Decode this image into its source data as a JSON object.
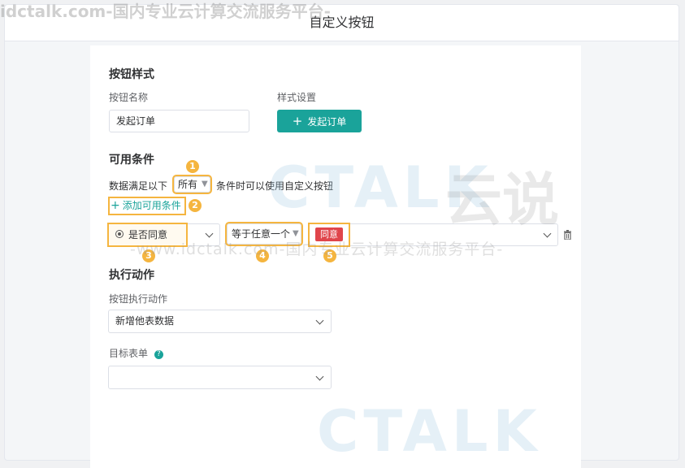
{
  "watermark_top": "idctalk.com-国内专业云计算交流服务平台-",
  "watermark_mid": "-www.idctalk.com-国内专业云计算交流服务平台-",
  "watermark_logo_text": "CTALK",
  "watermark_logo_cn": "云说",
  "page_title": "自定义按钮",
  "button_style": {
    "section_title": "按钮样式",
    "name_label": "按钮名称",
    "name_value": "发起订单",
    "style_label": "样式设置",
    "preview_plus": "+",
    "preview_label": "发起订单"
  },
  "conditions": {
    "section_title": "可用条件",
    "sentence_prefix": "数据满足以下",
    "match_select": "所有",
    "sentence_suffix": "条件时可以使用自定义按钮",
    "add_plus": "+",
    "add_label": "添加可用条件",
    "field_value": "是否同意",
    "operator_value": "等于任意一个",
    "tag_value": "同意",
    "badges": [
      "1",
      "2",
      "3",
      "4",
      "5"
    ]
  },
  "action": {
    "section_title": "执行动作",
    "action_label": "按钮执行动作",
    "action_value": "新增他表数据",
    "target_label": "目标表单",
    "target_value": ""
  },
  "colors": {
    "accent": "#1aa39a",
    "highlight": "#f5b53f",
    "tag_red": "#e0454b"
  }
}
